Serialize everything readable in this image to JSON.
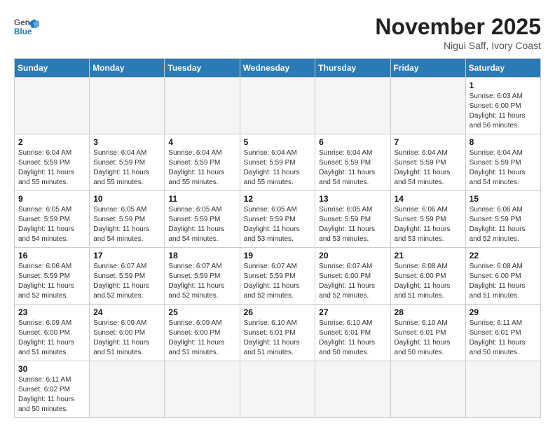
{
  "header": {
    "logo_general": "General",
    "logo_blue": "Blue",
    "month_title": "November 2025",
    "location": "Nigui Saff, Ivory Coast"
  },
  "weekdays": [
    "Sunday",
    "Monday",
    "Tuesday",
    "Wednesday",
    "Thursday",
    "Friday",
    "Saturday"
  ],
  "weeks": [
    [
      {
        "day": "",
        "info": ""
      },
      {
        "day": "",
        "info": ""
      },
      {
        "day": "",
        "info": ""
      },
      {
        "day": "",
        "info": ""
      },
      {
        "day": "",
        "info": ""
      },
      {
        "day": "",
        "info": ""
      },
      {
        "day": "1",
        "info": "Sunrise: 6:03 AM\nSunset: 6:00 PM\nDaylight: 11 hours\nand 56 minutes."
      }
    ],
    [
      {
        "day": "2",
        "info": "Sunrise: 6:04 AM\nSunset: 5:59 PM\nDaylight: 11 hours\nand 55 minutes."
      },
      {
        "day": "3",
        "info": "Sunrise: 6:04 AM\nSunset: 5:59 PM\nDaylight: 11 hours\nand 55 minutes."
      },
      {
        "day": "4",
        "info": "Sunrise: 6:04 AM\nSunset: 5:59 PM\nDaylight: 11 hours\nand 55 minutes."
      },
      {
        "day": "5",
        "info": "Sunrise: 6:04 AM\nSunset: 5:59 PM\nDaylight: 11 hours\nand 55 minutes."
      },
      {
        "day": "6",
        "info": "Sunrise: 6:04 AM\nSunset: 5:59 PM\nDaylight: 11 hours\nand 54 minutes."
      },
      {
        "day": "7",
        "info": "Sunrise: 6:04 AM\nSunset: 5:59 PM\nDaylight: 11 hours\nand 54 minutes."
      },
      {
        "day": "8",
        "info": "Sunrise: 6:04 AM\nSunset: 5:59 PM\nDaylight: 11 hours\nand 54 minutes."
      }
    ],
    [
      {
        "day": "9",
        "info": "Sunrise: 6:05 AM\nSunset: 5:59 PM\nDaylight: 11 hours\nand 54 minutes."
      },
      {
        "day": "10",
        "info": "Sunrise: 6:05 AM\nSunset: 5:59 PM\nDaylight: 11 hours\nand 54 minutes."
      },
      {
        "day": "11",
        "info": "Sunrise: 6:05 AM\nSunset: 5:59 PM\nDaylight: 11 hours\nand 54 minutes."
      },
      {
        "day": "12",
        "info": "Sunrise: 6:05 AM\nSunset: 5:59 PM\nDaylight: 11 hours\nand 53 minutes."
      },
      {
        "day": "13",
        "info": "Sunrise: 6:05 AM\nSunset: 5:59 PM\nDaylight: 11 hours\nand 53 minutes."
      },
      {
        "day": "14",
        "info": "Sunrise: 6:06 AM\nSunset: 5:59 PM\nDaylight: 11 hours\nand 53 minutes."
      },
      {
        "day": "15",
        "info": "Sunrise: 6:06 AM\nSunset: 5:59 PM\nDaylight: 11 hours\nand 52 minutes."
      }
    ],
    [
      {
        "day": "16",
        "info": "Sunrise: 6:06 AM\nSunset: 5:59 PM\nDaylight: 11 hours\nand 52 minutes."
      },
      {
        "day": "17",
        "info": "Sunrise: 6:07 AM\nSunset: 5:59 PM\nDaylight: 11 hours\nand 52 minutes."
      },
      {
        "day": "18",
        "info": "Sunrise: 6:07 AM\nSunset: 5:59 PM\nDaylight: 11 hours\nand 52 minutes."
      },
      {
        "day": "19",
        "info": "Sunrise: 6:07 AM\nSunset: 5:59 PM\nDaylight: 11 hours\nand 52 minutes."
      },
      {
        "day": "20",
        "info": "Sunrise: 6:07 AM\nSunset: 6:00 PM\nDaylight: 11 hours\nand 52 minutes."
      },
      {
        "day": "21",
        "info": "Sunrise: 6:08 AM\nSunset: 6:00 PM\nDaylight: 11 hours\nand 51 minutes."
      },
      {
        "day": "22",
        "info": "Sunrise: 6:08 AM\nSunset: 6:00 PM\nDaylight: 11 hours\nand 51 minutes."
      }
    ],
    [
      {
        "day": "23",
        "info": "Sunrise: 6:09 AM\nSunset: 6:00 PM\nDaylight: 11 hours\nand 51 minutes."
      },
      {
        "day": "24",
        "info": "Sunrise: 6:09 AM\nSunset: 6:00 PM\nDaylight: 11 hours\nand 51 minutes."
      },
      {
        "day": "25",
        "info": "Sunrise: 6:09 AM\nSunset: 6:00 PM\nDaylight: 11 hours\nand 51 minutes."
      },
      {
        "day": "26",
        "info": "Sunrise: 6:10 AM\nSunset: 6:01 PM\nDaylight: 11 hours\nand 51 minutes."
      },
      {
        "day": "27",
        "info": "Sunrise: 6:10 AM\nSunset: 6:01 PM\nDaylight: 11 hours\nand 50 minutes."
      },
      {
        "day": "28",
        "info": "Sunrise: 6:10 AM\nSunset: 6:01 PM\nDaylight: 11 hours\nand 50 minutes."
      },
      {
        "day": "29",
        "info": "Sunrise: 6:11 AM\nSunset: 6:01 PM\nDaylight: 11 hours\nand 50 minutes."
      }
    ],
    [
      {
        "day": "30",
        "info": "Sunrise: 6:11 AM\nSunset: 6:02 PM\nDaylight: 11 hours\nand 50 minutes."
      },
      {
        "day": "",
        "info": ""
      },
      {
        "day": "",
        "info": ""
      },
      {
        "day": "",
        "info": ""
      },
      {
        "day": "",
        "info": ""
      },
      {
        "day": "",
        "info": ""
      },
      {
        "day": "",
        "info": ""
      }
    ]
  ]
}
